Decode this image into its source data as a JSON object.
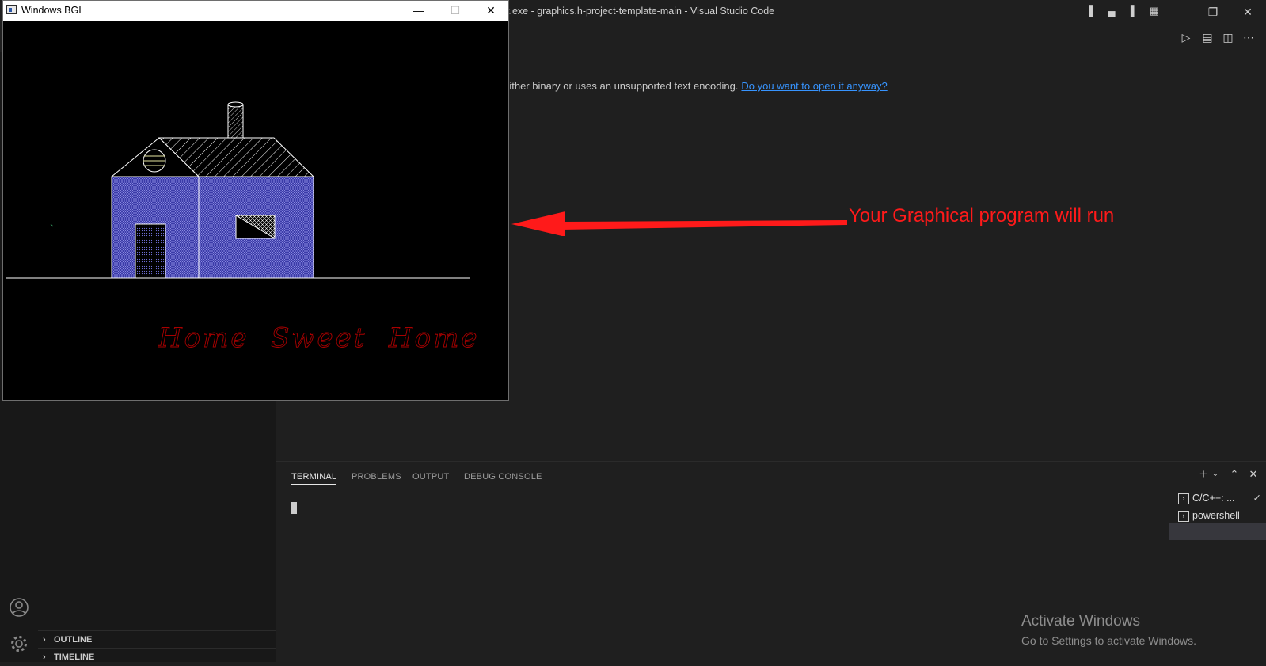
{
  "vscode": {
    "title": "t.exe - graphics.h-project-template-main - Visual Studio Code",
    "window_controls": {
      "minimize": "—",
      "restore": "❐",
      "close": "✕"
    },
    "editor": {
      "message": "s either binary or uses an unsupported text encoding.",
      "link": "Do you want to open it anyway?"
    },
    "sidebar": {
      "sections": [
        {
          "label": "OUTLINE"
        },
        {
          "label": "TIMELINE"
        }
      ]
    },
    "panel": {
      "tabs": [
        {
          "label": "TERMINAL",
          "active": true
        },
        {
          "label": "PROBLEMS",
          "active": false
        },
        {
          "label": "OUTPUT",
          "active": false
        },
        {
          "label": "DEBUG CONSOLE",
          "active": false
        }
      ],
      "terminals": [
        {
          "label": "C/C++: ...",
          "status": "✓"
        },
        {
          "label": "powershell"
        }
      ]
    }
  },
  "annotation": {
    "text": "Your Graphical program will run",
    "color": "#ff1a1a"
  },
  "bgi_window": {
    "title": "Windows BGI",
    "controls": {
      "minimize": "—",
      "maximize": "☐",
      "close": "✕"
    },
    "drawing": {
      "caption": "Home  Sweet  Home",
      "caption_color": "#a80000",
      "wall_color": "#3b3ba8"
    }
  },
  "activate_windows": {
    "title": "Activate Windows",
    "subtitle": "Go to Settings to activate Windows."
  }
}
